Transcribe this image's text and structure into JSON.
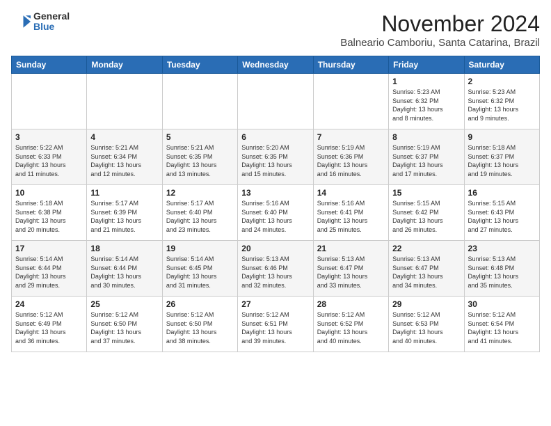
{
  "header": {
    "logo_line1": "General",
    "logo_line2": "Blue",
    "month": "November 2024",
    "location": "Balneario Camboriu, Santa Catarina, Brazil"
  },
  "weekdays": [
    "Sunday",
    "Monday",
    "Tuesday",
    "Wednesday",
    "Thursday",
    "Friday",
    "Saturday"
  ],
  "weeks": [
    [
      {
        "day": "",
        "info": ""
      },
      {
        "day": "",
        "info": ""
      },
      {
        "day": "",
        "info": ""
      },
      {
        "day": "",
        "info": ""
      },
      {
        "day": "",
        "info": ""
      },
      {
        "day": "1",
        "info": "Sunrise: 5:23 AM\nSunset: 6:32 PM\nDaylight: 13 hours\nand 8 minutes."
      },
      {
        "day": "2",
        "info": "Sunrise: 5:23 AM\nSunset: 6:32 PM\nDaylight: 13 hours\nand 9 minutes."
      }
    ],
    [
      {
        "day": "3",
        "info": "Sunrise: 5:22 AM\nSunset: 6:33 PM\nDaylight: 13 hours\nand 11 minutes."
      },
      {
        "day": "4",
        "info": "Sunrise: 5:21 AM\nSunset: 6:34 PM\nDaylight: 13 hours\nand 12 minutes."
      },
      {
        "day": "5",
        "info": "Sunrise: 5:21 AM\nSunset: 6:35 PM\nDaylight: 13 hours\nand 13 minutes."
      },
      {
        "day": "6",
        "info": "Sunrise: 5:20 AM\nSunset: 6:35 PM\nDaylight: 13 hours\nand 15 minutes."
      },
      {
        "day": "7",
        "info": "Sunrise: 5:19 AM\nSunset: 6:36 PM\nDaylight: 13 hours\nand 16 minutes."
      },
      {
        "day": "8",
        "info": "Sunrise: 5:19 AM\nSunset: 6:37 PM\nDaylight: 13 hours\nand 17 minutes."
      },
      {
        "day": "9",
        "info": "Sunrise: 5:18 AM\nSunset: 6:37 PM\nDaylight: 13 hours\nand 19 minutes."
      }
    ],
    [
      {
        "day": "10",
        "info": "Sunrise: 5:18 AM\nSunset: 6:38 PM\nDaylight: 13 hours\nand 20 minutes."
      },
      {
        "day": "11",
        "info": "Sunrise: 5:17 AM\nSunset: 6:39 PM\nDaylight: 13 hours\nand 21 minutes."
      },
      {
        "day": "12",
        "info": "Sunrise: 5:17 AM\nSunset: 6:40 PM\nDaylight: 13 hours\nand 23 minutes."
      },
      {
        "day": "13",
        "info": "Sunrise: 5:16 AM\nSunset: 6:40 PM\nDaylight: 13 hours\nand 24 minutes."
      },
      {
        "day": "14",
        "info": "Sunrise: 5:16 AM\nSunset: 6:41 PM\nDaylight: 13 hours\nand 25 minutes."
      },
      {
        "day": "15",
        "info": "Sunrise: 5:15 AM\nSunset: 6:42 PM\nDaylight: 13 hours\nand 26 minutes."
      },
      {
        "day": "16",
        "info": "Sunrise: 5:15 AM\nSunset: 6:43 PM\nDaylight: 13 hours\nand 27 minutes."
      }
    ],
    [
      {
        "day": "17",
        "info": "Sunrise: 5:14 AM\nSunset: 6:44 PM\nDaylight: 13 hours\nand 29 minutes."
      },
      {
        "day": "18",
        "info": "Sunrise: 5:14 AM\nSunset: 6:44 PM\nDaylight: 13 hours\nand 30 minutes."
      },
      {
        "day": "19",
        "info": "Sunrise: 5:14 AM\nSunset: 6:45 PM\nDaylight: 13 hours\nand 31 minutes."
      },
      {
        "day": "20",
        "info": "Sunrise: 5:13 AM\nSunset: 6:46 PM\nDaylight: 13 hours\nand 32 minutes."
      },
      {
        "day": "21",
        "info": "Sunrise: 5:13 AM\nSunset: 6:47 PM\nDaylight: 13 hours\nand 33 minutes."
      },
      {
        "day": "22",
        "info": "Sunrise: 5:13 AM\nSunset: 6:47 PM\nDaylight: 13 hours\nand 34 minutes."
      },
      {
        "day": "23",
        "info": "Sunrise: 5:13 AM\nSunset: 6:48 PM\nDaylight: 13 hours\nand 35 minutes."
      }
    ],
    [
      {
        "day": "24",
        "info": "Sunrise: 5:12 AM\nSunset: 6:49 PM\nDaylight: 13 hours\nand 36 minutes."
      },
      {
        "day": "25",
        "info": "Sunrise: 5:12 AM\nSunset: 6:50 PM\nDaylight: 13 hours\nand 37 minutes."
      },
      {
        "day": "26",
        "info": "Sunrise: 5:12 AM\nSunset: 6:50 PM\nDaylight: 13 hours\nand 38 minutes."
      },
      {
        "day": "27",
        "info": "Sunrise: 5:12 AM\nSunset: 6:51 PM\nDaylight: 13 hours\nand 39 minutes."
      },
      {
        "day": "28",
        "info": "Sunrise: 5:12 AM\nSunset: 6:52 PM\nDaylight: 13 hours\nand 40 minutes."
      },
      {
        "day": "29",
        "info": "Sunrise: 5:12 AM\nSunset: 6:53 PM\nDaylight: 13 hours\nand 40 minutes."
      },
      {
        "day": "30",
        "info": "Sunrise: 5:12 AM\nSunset: 6:54 PM\nDaylight: 13 hours\nand 41 minutes."
      }
    ]
  ],
  "accent_color": "#2a6db5"
}
